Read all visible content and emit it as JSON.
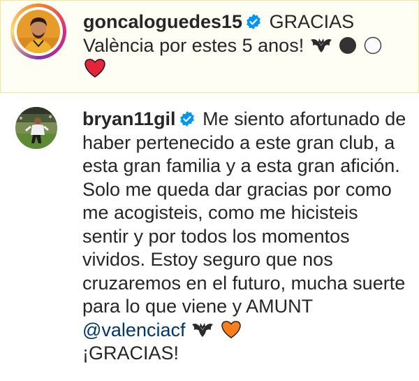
{
  "comments": [
    {
      "username": "goncaloguedes15",
      "verified_icon": "verified-badge-icon",
      "text_line1": "GRACIAS",
      "text_line2": "València por estes 5 anos!",
      "emojis": [
        "bat-icon",
        "black-circle-icon",
        "white-circle-icon",
        "red-heart-icon"
      ],
      "highlight_color": "#fffef5"
    },
    {
      "username": "bryan11gil",
      "verified_icon": "verified-badge-icon",
      "text": "Me siento afortunado de haber pertenecido a este gran club, a esta gran familia y a esta gran afición. Solo me queda dar gracias por como me acogisteis, como me hicisteis sentir y por todos los momentos vividos. Estoy seguro que nos cruzaremos en el futuro, mucha suerte para lo que viene y AMUNT",
      "mention": "@valenciacf",
      "emojis": [
        "bat-icon",
        "orange-heart-icon"
      ],
      "closing": "¡GRACIAS!"
    }
  ],
  "colors": {
    "text": "#262626",
    "mention": "#00376b",
    "verified": "#0095f6",
    "red_heart": "#e8243a",
    "orange_heart": "#f77f1b"
  }
}
